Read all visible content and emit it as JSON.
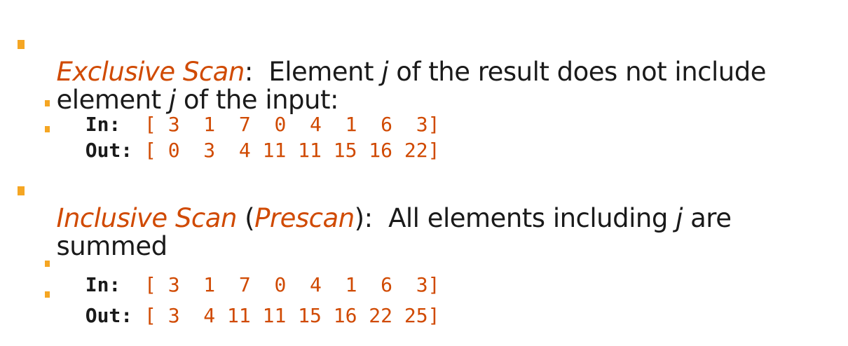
{
  "colors": {
    "accent": "#D04A02",
    "bullet": "#F5A623",
    "text": "#1a1a1a"
  },
  "exclusive": {
    "term": "Exclusive Scan",
    "colon": ":  ",
    "desc_before_j": "Element ",
    "j1": "j",
    "desc_after_j": " of the result does not include",
    "line2_before_j": "element ",
    "j2": "j",
    "line2_after_j": " of the input:",
    "in_label": "In:  ",
    "in_array": "[ 3  1  7  0  4  1  6  3]",
    "out_label": "Out: ",
    "out_array": "[ 0  3  4 11 11 15 16 22]"
  },
  "inclusive": {
    "term": "Inclusive Scan",
    "paren_open": " (",
    "alias": "Prescan",
    "paren_close": "):  ",
    "desc_before_j": "All elements including ",
    "j": "j",
    "desc_after_j": " are",
    "line2": "summed",
    "in_label": "In:  ",
    "in_array": "[ 3  1  7  0  4  1  6  3]",
    "out_label": "Out: ",
    "out_array": "[ 3  4 11 11 15 16 22 25]"
  }
}
